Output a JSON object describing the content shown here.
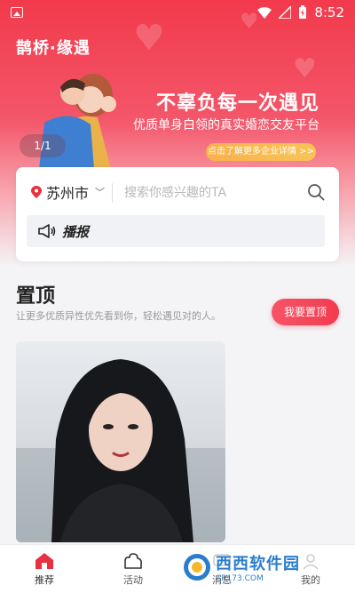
{
  "status_bar": {
    "time": "8:52"
  },
  "hero": {
    "brand": "鹊桥·缘遇",
    "slogan_title": "不辜负每一次遇见",
    "slogan_sub": "优质单身白领的真实婚恋交友平台",
    "more_button": "点击了解更多企业详情 >>",
    "pager": "1/1"
  },
  "search": {
    "city": "苏州市",
    "placeholder": "搜索你感兴趣的TA",
    "broadcast_label": "播报"
  },
  "top_section": {
    "title": "置顶",
    "subtitle": "让更多优质异性优先看到你，轻松遇见对的人。",
    "button": "我要置顶"
  },
  "bottom_nav": {
    "items": [
      {
        "label": "推荐",
        "icon": "home-icon",
        "active": true
      },
      {
        "label": "活动",
        "icon": "activity-icon",
        "active": false
      },
      {
        "label": "消息",
        "icon": "message-icon",
        "active": false
      },
      {
        "label": "我的",
        "icon": "profile-icon",
        "active": false
      }
    ]
  },
  "watermark": {
    "text": "西西软件园",
    "sub": "CR173.COM"
  },
  "colors": {
    "accent": "#f23a4c",
    "gold": "#f9b14c"
  }
}
